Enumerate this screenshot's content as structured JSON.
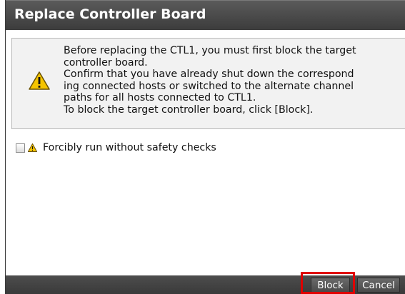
{
  "dialog": {
    "title": "Replace Controller Board",
    "message": {
      "icon": "warning-icon",
      "lines": [
        "Before replacing the CTL1, you must first block the target",
        "controller board.",
        "Confirm that you have already shut down the correspond",
        "ing connected hosts or switched to the alternate channel",
        "paths for all hosts connected to CTL1.",
        "To block the target controller board, click [Block]."
      ]
    },
    "option": {
      "checked": false,
      "icon": "warning-small-icon",
      "label": "Forcibly run without safety checks"
    },
    "buttons": {
      "block_label": "Block",
      "cancel_label": "Cancel"
    }
  },
  "colors": {
    "titlebar": "#4a4a4a",
    "footer": "#434343",
    "highlight": "#e00000",
    "warning": "#f5c400"
  }
}
